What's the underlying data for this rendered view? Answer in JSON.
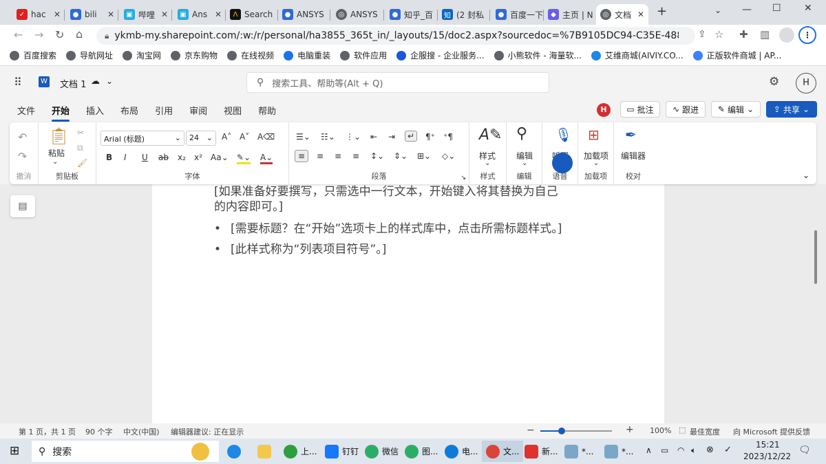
{
  "browser": {
    "tabs": [
      {
        "label": "hac",
        "icon": "hao123-icon",
        "color": "#e02020"
      },
      {
        "label": "bili",
        "icon": "paw-icon",
        "color": "#2d6bd9"
      },
      {
        "label": "哔哩",
        "icon": "bilibili-icon",
        "color": "#23ade5"
      },
      {
        "label": "Ans",
        "icon": "bilibili-icon",
        "color": "#23ade5"
      },
      {
        "label": "Search",
        "icon": "ansys-icon",
        "color": "#111"
      },
      {
        "label": "ANSYS",
        "icon": "paw-icon",
        "color": "#2d6bd9"
      },
      {
        "label": "ANSYS",
        "icon": "globe-icon",
        "color": "#5f6368"
      },
      {
        "label": "知乎_百",
        "icon": "paw-icon",
        "color": "#2d6bd9"
      },
      {
        "label": "(2 封私",
        "icon": "zhihu-icon",
        "color": "#0a66c2"
      },
      {
        "label": "百度一下",
        "icon": "paw-icon",
        "color": "#2d6bd9"
      },
      {
        "label": "主页 | N",
        "icon": "extension-icon",
        "color": "#6c5ce7"
      },
      {
        "label": "文档",
        "icon": "globe-icon",
        "color": "#5f6368"
      }
    ],
    "url": "ykmb-my.sharepoint.com/:w:/r/personal/ha3855_365t_in/_layouts/15/doc2.aspx?sourcedoc=%7B9105DC94-C35E-4887-8B02-BE8...",
    "bookmarks": [
      "百度搜索",
      "导航网址",
      "淘宝网",
      "京东购物",
      "在线视频",
      "电脑重装",
      "软件应用",
      "企服搜 - 企业服务...",
      "小熊软件 - 海量软...",
      "艾维商城(AIVIY.CO...",
      "正版软件商城 | AP..."
    ]
  },
  "word": {
    "doc_title": "文档 1",
    "search_placeholder": "搜索工具、帮助等(Alt + Q)",
    "avatar": "H",
    "menu": [
      "文件",
      "开始",
      "插入",
      "布局",
      "引用",
      "审阅",
      "视图",
      "帮助"
    ],
    "comments": "批注",
    "track": "跟进",
    "edit": "编辑",
    "share": "共享",
    "presence": "H",
    "ribbon": {
      "undo": "撤消",
      "paste": "粘贴",
      "clipboard": "剪贴板",
      "font_name": "Arial (标题)",
      "font_size": "24",
      "font": "字体",
      "paragraph": "段落",
      "styles": "样式",
      "styles_group": "样式",
      "editing": "编辑",
      "editing_group": "编辑",
      "dictate": "听写",
      "voice": "语音",
      "addins": "加载项",
      "addins_group": "加载项",
      "editor": "编辑器",
      "proofing": "校对"
    },
    "body": [
      "[如果准备好要撰写，只需选中一行文本，开始键入将其替换为自己",
      "的内容即可。]",
      "[需要标题？在“开始”选项卡上的样式库中，点击所需标题样式。]",
      "[此样式称为“列表项目符号”。]"
    ],
    "status": {
      "page": "第 1 页，共 1 页",
      "words": "90 个字",
      "lang": "中文(中国)",
      "editor": "编辑器建议: 正在显示",
      "zoom": "100%",
      "fit": "最佳宽度",
      "feedback": "向 Microsoft 提供反馈",
      "zoom_level": 0.3
    }
  },
  "taskbar": {
    "search": "搜索",
    "apps": [
      "上...",
      "钉钉",
      "微信",
      "图...",
      "电...",
      "文...",
      "新...",
      "*...",
      "*..."
    ],
    "time": "15:21",
    "date": "2023/12/22"
  }
}
